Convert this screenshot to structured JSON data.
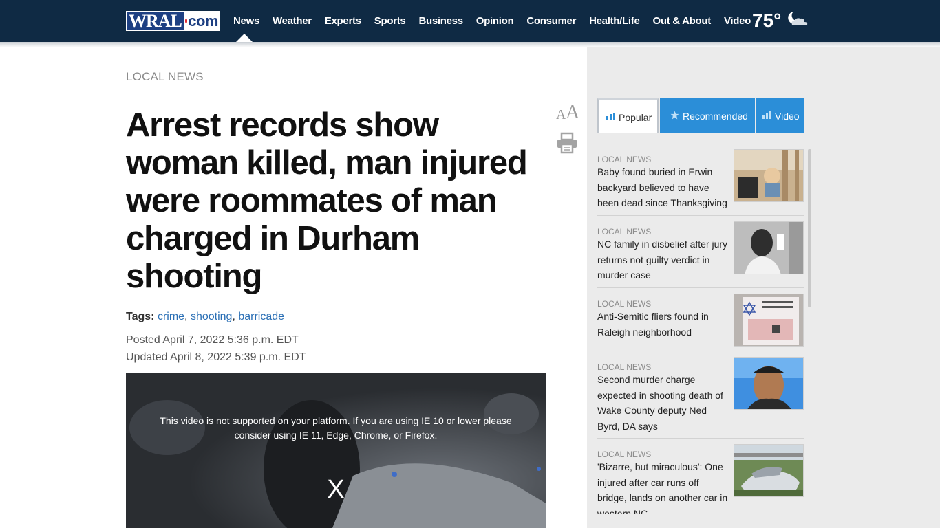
{
  "header": {
    "logo_wral": "WRAL",
    "logo_com": "com",
    "nav": [
      "News",
      "Weather",
      "Experts",
      "Sports",
      "Business",
      "Opinion",
      "Consumer",
      "Health/Life",
      "Out & About",
      "Video"
    ],
    "active_nav": "News",
    "temperature": "75°",
    "weather_icon": "partly-cloudy-night-icon"
  },
  "article": {
    "kicker": "LOCAL NEWS",
    "headline": "Arrest records show woman killed, man injured were roommates of man charged in Durham shooting",
    "tags_label": "Tags:",
    "tags": [
      "crime",
      "shooting",
      "barricade"
    ],
    "posted": "Posted April 7, 2022 5:36 p.m. EDT",
    "updated": "Updated April 8, 2022 5:39 p.m. EDT",
    "video_message": "This video is not supported on your platform. If you are using IE 10 or lower please consider using IE 11, Edge, Chrome, or Firefox.",
    "video_close": "X",
    "font_size_glyph_small": "A",
    "font_size_glyph_large": "A"
  },
  "sidebar": {
    "tabs": [
      {
        "label": "Popular",
        "active": true
      },
      {
        "label": "Recommended",
        "active": false
      },
      {
        "label": "Video",
        "active": false
      }
    ],
    "stories": [
      {
        "kicker": "LOCAL NEWS",
        "title": "Baby found buried in Erwin backyard believed to have been dead since Thanksgiving"
      },
      {
        "kicker": "LOCAL NEWS",
        "title": "NC family in disbelief after jury returns not guilty verdict in murder case"
      },
      {
        "kicker": "LOCAL NEWS",
        "title": "Anti-Semitic fliers found in Raleigh neighborhood"
      },
      {
        "kicker": "LOCAL NEWS",
        "title": "Second murder charge expected in shooting death of Wake County deputy Ned Byrd, DA says"
      },
      {
        "kicker": "LOCAL NEWS",
        "title": "'Bizarre, but miraculous': One injured after car runs off bridge, lands on another car in western NC"
      }
    ]
  },
  "colors": {
    "topbar": "#0f2a44",
    "accent_blue": "#2b8ed8",
    "link": "#2a6fb5",
    "sidebar_bg": "#ebebeb"
  }
}
